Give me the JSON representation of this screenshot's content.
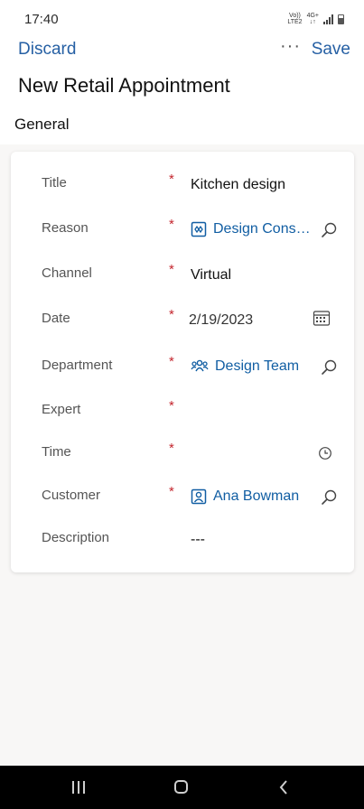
{
  "status": {
    "time": "17:40",
    "volte": "Vo)) LTE2",
    "network": "4G+"
  },
  "command_bar": {
    "discard_label": "Discard",
    "more_label": "···",
    "save_label": "Save"
  },
  "page": {
    "title": "New Retail Appointment",
    "tab": "General"
  },
  "form": {
    "fields": [
      {
        "label": "Title",
        "required": "*",
        "value": "Kitchen design"
      },
      {
        "label": "Reason",
        "required": "*",
        "value": "Design Consu...",
        "icon": "product-icon",
        "action_icon": "search-icon"
      },
      {
        "label": "Channel",
        "required": "*",
        "value": "Virtual"
      },
      {
        "label": "Date",
        "required": "*",
        "value": "2/19/2023",
        "action_icon": "calendar-icon"
      },
      {
        "label": "Department",
        "required": "*",
        "value": "Design Team",
        "icon": "team-icon",
        "action_icon": "search-icon"
      },
      {
        "label": "Expert",
        "required": "*",
        "value": ""
      },
      {
        "label": "Time",
        "required": "*",
        "value": "",
        "action_icon": "clock-icon"
      },
      {
        "label": "Customer",
        "required": "*",
        "value": "Ana Bowman",
        "icon": "contact-icon",
        "action_icon": "search-icon"
      },
      {
        "label": "Description",
        "required": "",
        "value": "---"
      }
    ]
  },
  "colors": {
    "link": "#115ea3",
    "command": "#2660a4",
    "required": "#c4262e"
  }
}
